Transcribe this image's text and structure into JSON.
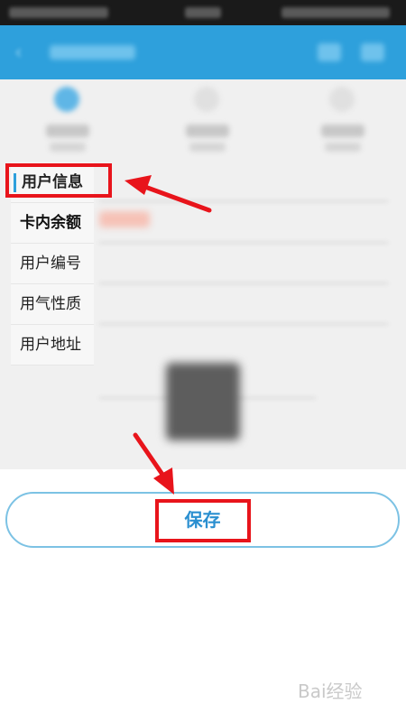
{
  "menu": {
    "items": [
      {
        "label": "用户信息",
        "active": true
      },
      {
        "label": "卡内余额"
      },
      {
        "label": "用户编号"
      },
      {
        "label": "用气性质"
      },
      {
        "label": "用户地址"
      }
    ]
  },
  "save_button": {
    "label": "保存"
  },
  "watermark": {
    "text": "Bai经验"
  },
  "colors": {
    "appbar": "#2ea0dc",
    "highlight": "#e8141b",
    "save_text": "#2a8fd0",
    "save_border": "#7cc2e4"
  },
  "icons": [
    "back-arrow-icon",
    "step-icon",
    "qr-code-icon",
    "annotation-arrow-icon"
  ]
}
